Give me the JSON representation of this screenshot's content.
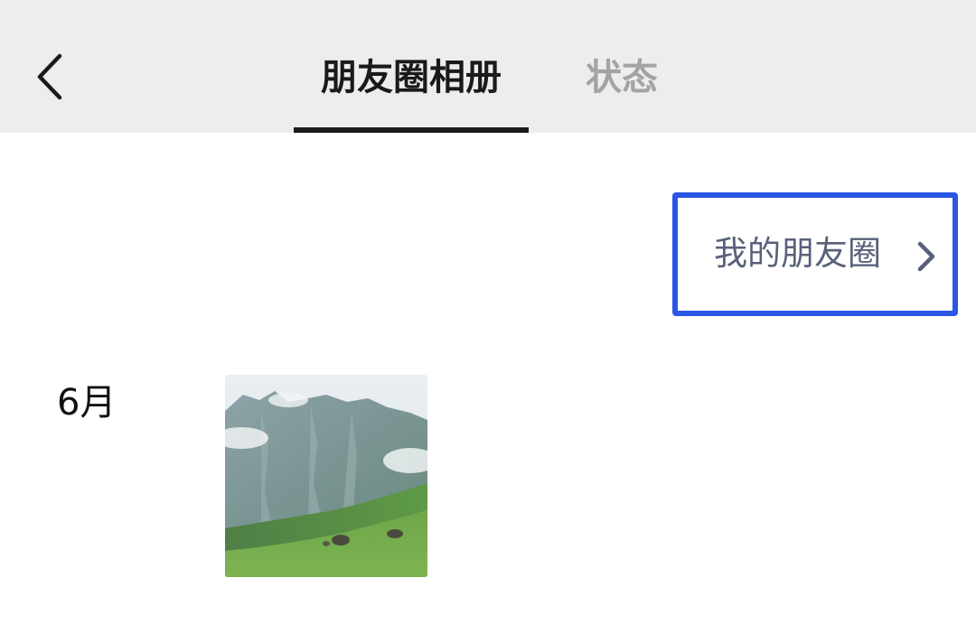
{
  "header": {
    "tabs": [
      {
        "label": "朋友圈相册",
        "active": true
      },
      {
        "label": "状态",
        "active": false
      }
    ]
  },
  "moments_link": {
    "label": "我的朋友圈"
  },
  "album": {
    "sections": [
      {
        "month": "6月",
        "photo_count": 1
      }
    ]
  },
  "colors": {
    "header_bg": "#ededed",
    "active_tab": "#1a1a1a",
    "inactive_tab": "#a3a3a3",
    "link_text": "#58617a",
    "highlight_border": "#2a55e5"
  },
  "icons": {
    "back": "chevron-left-icon",
    "link_arrow": "chevron-right-icon"
  }
}
